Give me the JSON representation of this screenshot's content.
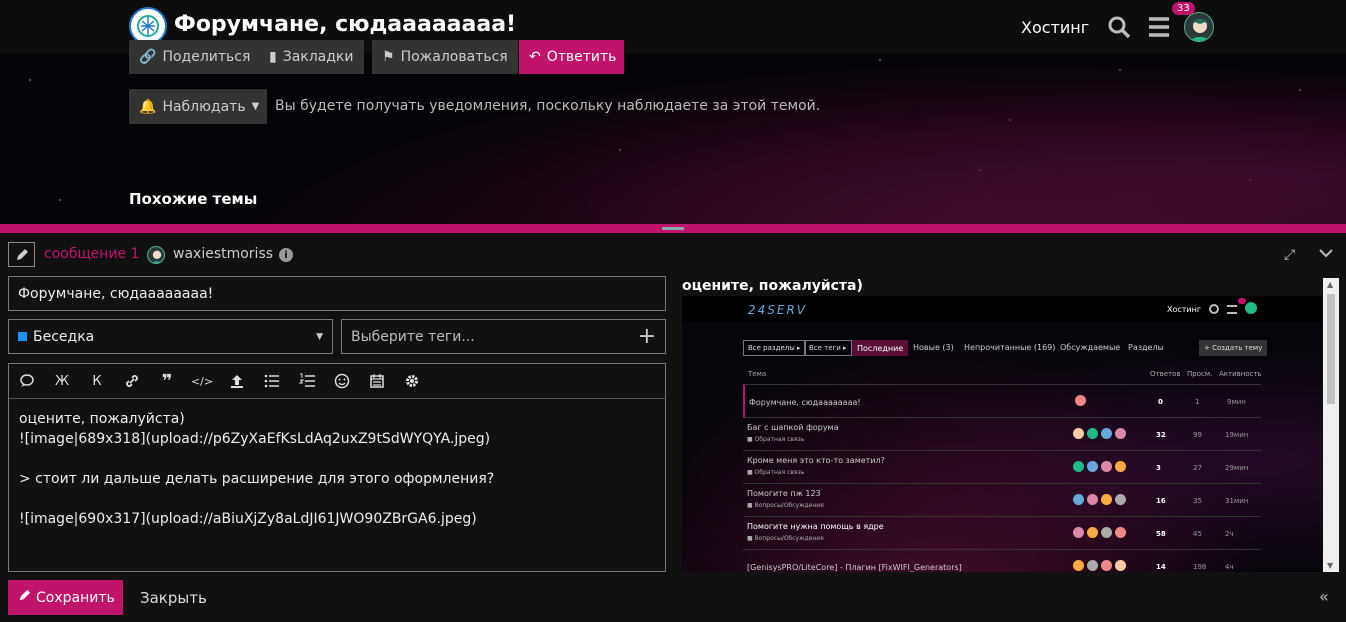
{
  "header": {
    "site_title": "Форумчане, сюдаааааааа!",
    "nav_link": "Хостинг",
    "notification_count": "33"
  },
  "topic_actions": {
    "share": "Поделиться",
    "bookmarks": "Закладки",
    "flag": "Пожаловаться",
    "reply": "Ответить",
    "watch": "Наблюдать",
    "watch_notice": "Вы будете получать уведомления, поскольку наблюдаете за этой темой."
  },
  "similar_topics_title": "Похожие темы",
  "composer": {
    "reply_to": "сообщение 1",
    "username": "waxiestmoriss",
    "title_value": "Форумчане, сюдаааааааа!",
    "category": "Беседка",
    "tags_placeholder": "Выберите теги...",
    "toolbar_italic": "Ж",
    "toolbar_bold": "К",
    "editor_lines": [
      "оцените, пожалуйста)",
      "![image|689x318](upload://p6ZyXaEfKsLdAq2uxZ9tSdWYQYA.jpeg)",
      "",
      "> стоит ли дальше делать расширение для этого оформления?",
      "",
      "![image|690x317](upload://aBiuXjZy8aLdJI61JWO90ZBrGA6.jpeg)"
    ],
    "preview_heading": "оцените, пожалуйста)",
    "save_label": "Сохранить",
    "close_label": "Закрыть"
  },
  "preview_image": {
    "logo_text": "24SERV",
    "nav_link": "Хостинг",
    "filter_all": "Все разделы ▸",
    "filter_tags": "Все теги ▸",
    "tabs": [
      "Последние",
      "Новые (3)",
      "Непрочитанные (169)",
      "Обсуждаемые",
      "Разделы"
    ],
    "create_button": "+ Создать тему",
    "columns": [
      "Тема",
      "Ответов",
      "Просм.",
      "Активность"
    ],
    "rows": [
      {
        "title": "Форумчане, сюдаааааааа!",
        "category": "",
        "replies": "0",
        "views": "1",
        "activity": "9мин"
      },
      {
        "title": "Баг с шапкой форума",
        "category": "Обратная связь",
        "replies": "32",
        "views": "99",
        "activity": "19мин"
      },
      {
        "title": "Кроме меня это кто-то заметил?",
        "category": "Обратная связь",
        "replies": "3",
        "views": "27",
        "activity": "29мин"
      },
      {
        "title": "Помогите пж 123",
        "category": "Вопросы/Обсуждения",
        "replies": "16",
        "views": "35",
        "activity": "31мин"
      },
      {
        "title": "Помогите нужна помощь в ядре",
        "category": "Вопросы/Обсуждения",
        "replies": "58",
        "views": "45",
        "activity": "2ч"
      },
      {
        "title": "[GenisysPRO/LiteCore] - Плагин [FixWIFI_Generators]",
        "category": "",
        "replies": "14",
        "views": "198",
        "activity": "4ч"
      }
    ]
  },
  "colors": {
    "accent": "#c0146b",
    "panel": "#111111",
    "button": "#333333"
  }
}
